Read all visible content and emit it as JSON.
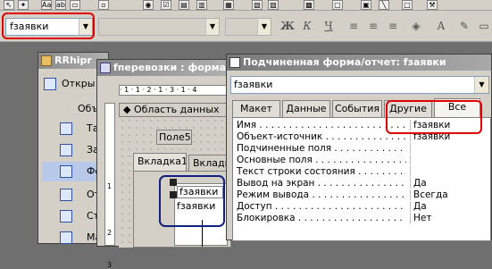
{
  "toolbar": {
    "object_combo_value": "fзаявки",
    "font_combo_value": "",
    "size_combo_value": "",
    "bold_label": "Ж",
    "italic_label": "К",
    "underline_label": "Ч"
  },
  "db_window": {
    "title": "RRhipr",
    "open_label": "Откры",
    "objects_label": "Объе",
    "items": [
      "Таб",
      "Зап",
      "Фо",
      "Отч",
      "Стр",
      "Ма"
    ]
  },
  "form_window": {
    "title": "fперевозки : форма",
    "ruler_text": "· 1 · 1 · 2 · 1 · 3 · 1 · 4",
    "section_label": "Область данных",
    "field_label": "Поле5",
    "tab1_label": "Вкладка1",
    "tab2_label": "Вкладк",
    "subform_label": "fзаявки",
    "subform_field": "fзаявки",
    "ruler_v": [
      "1",
      "2",
      "3"
    ]
  },
  "property_sheet": {
    "title": "Подчиненная форма/отчет: fзаявки",
    "selected_object": "fзаявки",
    "tabs": [
      "Макет",
      "Данные",
      "События",
      "Другие",
      "Все"
    ],
    "active_tab": "Все",
    "properties": [
      {
        "name": "Имя",
        "value": "fзаявки"
      },
      {
        "name": "Объект-источник",
        "value": "fзаявки"
      },
      {
        "name": "Подчиненные поля",
        "value": ""
      },
      {
        "name": "Основные поля",
        "value": ""
      },
      {
        "name": "Текст строки состояния",
        "value": ""
      },
      {
        "name": "Вывод на экран",
        "value": "Да"
      },
      {
        "name": "Режим вывода",
        "value": "Всегда"
      },
      {
        "name": "Доступ",
        "value": "Да"
      },
      {
        "name": "Блокировка",
        "value": "Нет"
      }
    ]
  },
  "colors": {
    "highlight_red": "#e00000",
    "highlight_blue": "#102080"
  }
}
